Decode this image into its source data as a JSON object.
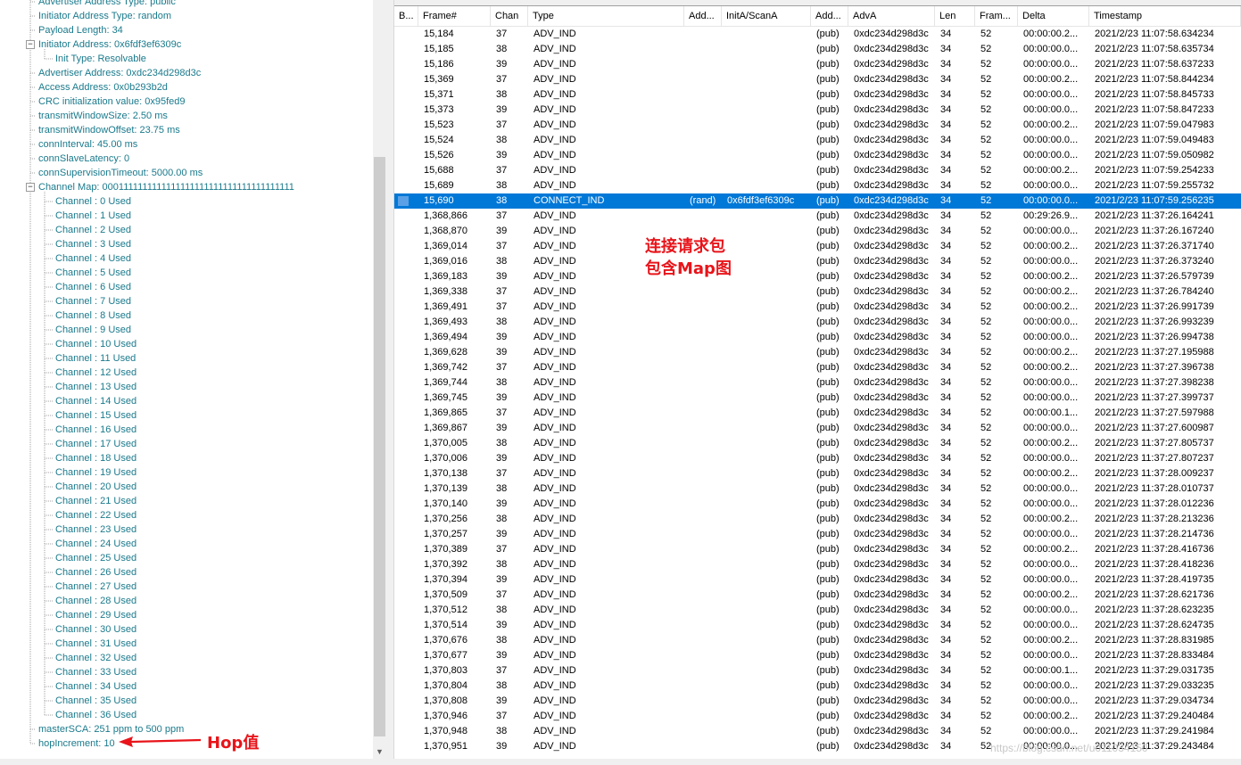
{
  "tree": {
    "nodes": [
      {
        "text": "Advertiser Address Type: public",
        "indent": 1,
        "toggle": ""
      },
      {
        "text": "Initiator Address Type: random",
        "indent": 1,
        "toggle": ""
      },
      {
        "text": "Payload Length: 34",
        "indent": 1,
        "toggle": ""
      },
      {
        "text": "Initiator Address: 0x6fdf3ef6309c",
        "indent": 1,
        "toggle": "−"
      },
      {
        "text": "Init Type: Resolvable",
        "indent": 2,
        "toggle": ""
      },
      {
        "text": "Advertiser Address: 0xdc234d298d3c",
        "indent": 1,
        "toggle": ""
      },
      {
        "text": "Access Address: 0x0b293b2d",
        "indent": 1,
        "toggle": ""
      },
      {
        "text": "CRC initialization value: 0x95fed9",
        "indent": 1,
        "toggle": ""
      },
      {
        "text": "transmitWindowSize: 2.50  ms",
        "indent": 1,
        "toggle": ""
      },
      {
        "text": "transmitWindowOffset: 23.75  ms",
        "indent": 1,
        "toggle": ""
      },
      {
        "text": "connInterval: 45.00  ms",
        "indent": 1,
        "toggle": ""
      },
      {
        "text": "connSlaveLatency: 0",
        "indent": 1,
        "toggle": ""
      },
      {
        "text": "connSupervisionTimeout: 5000.00  ms",
        "indent": 1,
        "toggle": ""
      },
      {
        "text": "Channel Map: 0001111111111111111111111111111111111111",
        "indent": 1,
        "toggle": "−"
      },
      {
        "text": "Channel : 0 Used",
        "indent": 2,
        "toggle": ""
      },
      {
        "text": "Channel : 1 Used",
        "indent": 2,
        "toggle": ""
      },
      {
        "text": "Channel : 2 Used",
        "indent": 2,
        "toggle": ""
      },
      {
        "text": "Channel : 3 Used",
        "indent": 2,
        "toggle": ""
      },
      {
        "text": "Channel : 4 Used",
        "indent": 2,
        "toggle": ""
      },
      {
        "text": "Channel : 5 Used",
        "indent": 2,
        "toggle": ""
      },
      {
        "text": "Channel : 6 Used",
        "indent": 2,
        "toggle": ""
      },
      {
        "text": "Channel : 7 Used",
        "indent": 2,
        "toggle": ""
      },
      {
        "text": "Channel : 8 Used",
        "indent": 2,
        "toggle": ""
      },
      {
        "text": "Channel : 9 Used",
        "indent": 2,
        "toggle": ""
      },
      {
        "text": "Channel : 10 Used",
        "indent": 2,
        "toggle": ""
      },
      {
        "text": "Channel : 11 Used",
        "indent": 2,
        "toggle": ""
      },
      {
        "text": "Channel : 12 Used",
        "indent": 2,
        "toggle": ""
      },
      {
        "text": "Channel : 13 Used",
        "indent": 2,
        "toggle": ""
      },
      {
        "text": "Channel : 14 Used",
        "indent": 2,
        "toggle": ""
      },
      {
        "text": "Channel : 15 Used",
        "indent": 2,
        "toggle": ""
      },
      {
        "text": "Channel : 16 Used",
        "indent": 2,
        "toggle": ""
      },
      {
        "text": "Channel : 17 Used",
        "indent": 2,
        "toggle": ""
      },
      {
        "text": "Channel : 18 Used",
        "indent": 2,
        "toggle": ""
      },
      {
        "text": "Channel : 19 Used",
        "indent": 2,
        "toggle": ""
      },
      {
        "text": "Channel : 20 Used",
        "indent": 2,
        "toggle": ""
      },
      {
        "text": "Channel : 21 Used",
        "indent": 2,
        "toggle": ""
      },
      {
        "text": "Channel : 22 Used",
        "indent": 2,
        "toggle": ""
      },
      {
        "text": "Channel : 23 Used",
        "indent": 2,
        "toggle": ""
      },
      {
        "text": "Channel : 24 Used",
        "indent": 2,
        "toggle": ""
      },
      {
        "text": "Channel : 25 Used",
        "indent": 2,
        "toggle": ""
      },
      {
        "text": "Channel : 26 Used",
        "indent": 2,
        "toggle": ""
      },
      {
        "text": "Channel : 27 Used",
        "indent": 2,
        "toggle": ""
      },
      {
        "text": "Channel : 28 Used",
        "indent": 2,
        "toggle": ""
      },
      {
        "text": "Channel : 29 Used",
        "indent": 2,
        "toggle": ""
      },
      {
        "text": "Channel : 30 Used",
        "indent": 2,
        "toggle": ""
      },
      {
        "text": "Channel : 31 Used",
        "indent": 2,
        "toggle": ""
      },
      {
        "text": "Channel : 32 Used",
        "indent": 2,
        "toggle": ""
      },
      {
        "text": "Channel : 33 Used",
        "indent": 2,
        "toggle": ""
      },
      {
        "text": "Channel : 34 Used",
        "indent": 2,
        "toggle": ""
      },
      {
        "text": "Channel : 35 Used",
        "indent": 2,
        "toggle": ""
      },
      {
        "text": "Channel : 36 Used",
        "indent": 2,
        "toggle": ""
      },
      {
        "text": "masterSCA: 251 ppm to 500 ppm",
        "indent": 1,
        "toggle": ""
      },
      {
        "text": "hopIncrement: 10",
        "indent": 1,
        "toggle": ""
      }
    ]
  },
  "grid": {
    "columns": [
      "B...",
      "Frame#",
      "Chan",
      "Type",
      "Add...",
      "InitA/ScanA",
      "Add...",
      "AdvA",
      "Len",
      "Fram...",
      "Delta",
      "Timestamp"
    ],
    "rows": [
      [
        "",
        "15,184",
        "37",
        "ADV_IND",
        "",
        "",
        "(pub)",
        "0xdc234d298d3c",
        "34",
        "52",
        "00:00:00.2...",
        "2021/2/23 11:07:58.634234"
      ],
      [
        "",
        "15,185",
        "38",
        "ADV_IND",
        "",
        "",
        "(pub)",
        "0xdc234d298d3c",
        "34",
        "52",
        "00:00:00.0...",
        "2021/2/23 11:07:58.635734"
      ],
      [
        "",
        "15,186",
        "39",
        "ADV_IND",
        "",
        "",
        "(pub)",
        "0xdc234d298d3c",
        "34",
        "52",
        "00:00:00.0...",
        "2021/2/23 11:07:58.637233"
      ],
      [
        "",
        "15,369",
        "37",
        "ADV_IND",
        "",
        "",
        "(pub)",
        "0xdc234d298d3c",
        "34",
        "52",
        "00:00:00.2...",
        "2021/2/23 11:07:58.844234"
      ],
      [
        "",
        "15,371",
        "38",
        "ADV_IND",
        "",
        "",
        "(pub)",
        "0xdc234d298d3c",
        "34",
        "52",
        "00:00:00.0...",
        "2021/2/23 11:07:58.845733"
      ],
      [
        "",
        "15,373",
        "39",
        "ADV_IND",
        "",
        "",
        "(pub)",
        "0xdc234d298d3c",
        "34",
        "52",
        "00:00:00.0...",
        "2021/2/23 11:07:58.847233"
      ],
      [
        "",
        "15,523",
        "37",
        "ADV_IND",
        "",
        "",
        "(pub)",
        "0xdc234d298d3c",
        "34",
        "52",
        "00:00:00.2...",
        "2021/2/23 11:07:59.047983"
      ],
      [
        "",
        "15,524",
        "38",
        "ADV_IND",
        "",
        "",
        "(pub)",
        "0xdc234d298d3c",
        "34",
        "52",
        "00:00:00.0...",
        "2021/2/23 11:07:59.049483"
      ],
      [
        "",
        "15,526",
        "39",
        "ADV_IND",
        "",
        "",
        "(pub)",
        "0xdc234d298d3c",
        "34",
        "52",
        "00:00:00.0...",
        "2021/2/23 11:07:59.050982"
      ],
      [
        "",
        "15,688",
        "37",
        "ADV_IND",
        "",
        "",
        "(pub)",
        "0xdc234d298d3c",
        "34",
        "52",
        "00:00:00.2...",
        "2021/2/23 11:07:59.254233"
      ],
      [
        "",
        "15,689",
        "38",
        "ADV_IND",
        "",
        "",
        "(pub)",
        "0xdc234d298d3c",
        "34",
        "52",
        "00:00:00.0...",
        "2021/2/23 11:07:59.255732"
      ],
      [
        "",
        "15,690",
        "38",
        "CONNECT_IND",
        "(rand)",
        "0x6fdf3ef6309c",
        "(pub)",
        "0xdc234d298d3c",
        "34",
        "52",
        "00:00:00.0...",
        "2021/2/23 11:07:59.256235"
      ],
      [
        "",
        "1,368,866",
        "37",
        "ADV_IND",
        "",
        "",
        "(pub)",
        "0xdc234d298d3c",
        "34",
        "52",
        "00:29:26.9...",
        "2021/2/23 11:37:26.164241"
      ],
      [
        "",
        "1,368,870",
        "39",
        "ADV_IND",
        "",
        "",
        "(pub)",
        "0xdc234d298d3c",
        "34",
        "52",
        "00:00:00.0...",
        "2021/2/23 11:37:26.167240"
      ],
      [
        "",
        "1,369,014",
        "37",
        "ADV_IND",
        "",
        "",
        "(pub)",
        "0xdc234d298d3c",
        "34",
        "52",
        "00:00:00.2...",
        "2021/2/23 11:37:26.371740"
      ],
      [
        "",
        "1,369,016",
        "38",
        "ADV_IND",
        "",
        "",
        "(pub)",
        "0xdc234d298d3c",
        "34",
        "52",
        "00:00:00.0...",
        "2021/2/23 11:37:26.373240"
      ],
      [
        "",
        "1,369,183",
        "39",
        "ADV_IND",
        "",
        "",
        "(pub)",
        "0xdc234d298d3c",
        "34",
        "52",
        "00:00:00.2...",
        "2021/2/23 11:37:26.579739"
      ],
      [
        "",
        "1,369,338",
        "37",
        "ADV_IND",
        "",
        "",
        "(pub)",
        "0xdc234d298d3c",
        "34",
        "52",
        "00:00:00.2...",
        "2021/2/23 11:37:26.784240"
      ],
      [
        "",
        "1,369,491",
        "37",
        "ADV_IND",
        "",
        "",
        "(pub)",
        "0xdc234d298d3c",
        "34",
        "52",
        "00:00:00.2...",
        "2021/2/23 11:37:26.991739"
      ],
      [
        "",
        "1,369,493",
        "38",
        "ADV_IND",
        "",
        "",
        "(pub)",
        "0xdc234d298d3c",
        "34",
        "52",
        "00:00:00.0...",
        "2021/2/23 11:37:26.993239"
      ],
      [
        "",
        "1,369,494",
        "39",
        "ADV_IND",
        "",
        "",
        "(pub)",
        "0xdc234d298d3c",
        "34",
        "52",
        "00:00:00.0...",
        "2021/2/23 11:37:26.994738"
      ],
      [
        "",
        "1,369,628",
        "39",
        "ADV_IND",
        "",
        "",
        "(pub)",
        "0xdc234d298d3c",
        "34",
        "52",
        "00:00:00.2...",
        "2021/2/23 11:37:27.195988"
      ],
      [
        "",
        "1,369,742",
        "37",
        "ADV_IND",
        "",
        "",
        "(pub)",
        "0xdc234d298d3c",
        "34",
        "52",
        "00:00:00.2...",
        "2021/2/23 11:37:27.396738"
      ],
      [
        "",
        "1,369,744",
        "38",
        "ADV_IND",
        "",
        "",
        "(pub)",
        "0xdc234d298d3c",
        "34",
        "52",
        "00:00:00.0...",
        "2021/2/23 11:37:27.398238"
      ],
      [
        "",
        "1,369,745",
        "39",
        "ADV_IND",
        "",
        "",
        "(pub)",
        "0xdc234d298d3c",
        "34",
        "52",
        "00:00:00.0...",
        "2021/2/23 11:37:27.399737"
      ],
      [
        "",
        "1,369,865",
        "37",
        "ADV_IND",
        "",
        "",
        "(pub)",
        "0xdc234d298d3c",
        "34",
        "52",
        "00:00:00.1...",
        "2021/2/23 11:37:27.597988"
      ],
      [
        "",
        "1,369,867",
        "39",
        "ADV_IND",
        "",
        "",
        "(pub)",
        "0xdc234d298d3c",
        "34",
        "52",
        "00:00:00.0...",
        "2021/2/23 11:37:27.600987"
      ],
      [
        "",
        "1,370,005",
        "38",
        "ADV_IND",
        "",
        "",
        "(pub)",
        "0xdc234d298d3c",
        "34",
        "52",
        "00:00:00.2...",
        "2021/2/23 11:37:27.805737"
      ],
      [
        "",
        "1,370,006",
        "39",
        "ADV_IND",
        "",
        "",
        "(pub)",
        "0xdc234d298d3c",
        "34",
        "52",
        "00:00:00.0...",
        "2021/2/23 11:37:27.807237"
      ],
      [
        "",
        "1,370,138",
        "37",
        "ADV_IND",
        "",
        "",
        "(pub)",
        "0xdc234d298d3c",
        "34",
        "52",
        "00:00:00.2...",
        "2021/2/23 11:37:28.009237"
      ],
      [
        "",
        "1,370,139",
        "38",
        "ADV_IND",
        "",
        "",
        "(pub)",
        "0xdc234d298d3c",
        "34",
        "52",
        "00:00:00.0...",
        "2021/2/23 11:37:28.010737"
      ],
      [
        "",
        "1,370,140",
        "39",
        "ADV_IND",
        "",
        "",
        "(pub)",
        "0xdc234d298d3c",
        "34",
        "52",
        "00:00:00.0...",
        "2021/2/23 11:37:28.012236"
      ],
      [
        "",
        "1,370,256",
        "38",
        "ADV_IND",
        "",
        "",
        "(pub)",
        "0xdc234d298d3c",
        "34",
        "52",
        "00:00:00.2...",
        "2021/2/23 11:37:28.213236"
      ],
      [
        "",
        "1,370,257",
        "39",
        "ADV_IND",
        "",
        "",
        "(pub)",
        "0xdc234d298d3c",
        "34",
        "52",
        "00:00:00.0...",
        "2021/2/23 11:37:28.214736"
      ],
      [
        "",
        "1,370,389",
        "37",
        "ADV_IND",
        "",
        "",
        "(pub)",
        "0xdc234d298d3c",
        "34",
        "52",
        "00:00:00.2...",
        "2021/2/23 11:37:28.416736"
      ],
      [
        "",
        "1,370,392",
        "38",
        "ADV_IND",
        "",
        "",
        "(pub)",
        "0xdc234d298d3c",
        "34",
        "52",
        "00:00:00.0...",
        "2021/2/23 11:37:28.418236"
      ],
      [
        "",
        "1,370,394",
        "39",
        "ADV_IND",
        "",
        "",
        "(pub)",
        "0xdc234d298d3c",
        "34",
        "52",
        "00:00:00.0...",
        "2021/2/23 11:37:28.419735"
      ],
      [
        "",
        "1,370,509",
        "37",
        "ADV_IND",
        "",
        "",
        "(pub)",
        "0xdc234d298d3c",
        "34",
        "52",
        "00:00:00.2...",
        "2021/2/23 11:37:28.621736"
      ],
      [
        "",
        "1,370,512",
        "38",
        "ADV_IND",
        "",
        "",
        "(pub)",
        "0xdc234d298d3c",
        "34",
        "52",
        "00:00:00.0...",
        "2021/2/23 11:37:28.623235"
      ],
      [
        "",
        "1,370,514",
        "39",
        "ADV_IND",
        "",
        "",
        "(pub)",
        "0xdc234d298d3c",
        "34",
        "52",
        "00:00:00.0...",
        "2021/2/23 11:37:28.624735"
      ],
      [
        "",
        "1,370,676",
        "38",
        "ADV_IND",
        "",
        "",
        "(pub)",
        "0xdc234d298d3c",
        "34",
        "52",
        "00:00:00.2...",
        "2021/2/23 11:37:28.831985"
      ],
      [
        "",
        "1,370,677",
        "39",
        "ADV_IND",
        "",
        "",
        "(pub)",
        "0xdc234d298d3c",
        "34",
        "52",
        "00:00:00.0...",
        "2021/2/23 11:37:28.833484"
      ],
      [
        "",
        "1,370,803",
        "37",
        "ADV_IND",
        "",
        "",
        "(pub)",
        "0xdc234d298d3c",
        "34",
        "52",
        "00:00:00.1...",
        "2021/2/23 11:37:29.031735"
      ],
      [
        "",
        "1,370,804",
        "38",
        "ADV_IND",
        "",
        "",
        "(pub)",
        "0xdc234d298d3c",
        "34",
        "52",
        "00:00:00.0...",
        "2021/2/23 11:37:29.033235"
      ],
      [
        "",
        "1,370,808",
        "39",
        "ADV_IND",
        "",
        "",
        "(pub)",
        "0xdc234d298d3c",
        "34",
        "52",
        "00:00:00.0...",
        "2021/2/23 11:37:29.034734"
      ],
      [
        "",
        "1,370,946",
        "37",
        "ADV_IND",
        "",
        "",
        "(pub)",
        "0xdc234d298d3c",
        "34",
        "52",
        "00:00:00.2...",
        "2021/2/23 11:37:29.240484"
      ],
      [
        "",
        "1,370,948",
        "38",
        "ADV_IND",
        "",
        "",
        "(pub)",
        "0xdc234d298d3c",
        "34",
        "52",
        "00:00:00.0...",
        "2021/2/23 11:37:29.241984"
      ],
      [
        "",
        "1,370,951",
        "39",
        "ADV_IND",
        "",
        "",
        "(pub)",
        "0xdc234d298d3c",
        "34",
        "52",
        "00:00:00.0...",
        "2021/2/23 11:37:29.243484"
      ]
    ],
    "selected_frame": "15,690"
  },
  "annotations": {
    "connect_note_line1": "连接请求包",
    "connect_note_line2": "包含Map图",
    "hop_note": "Hop值",
    "color": "#e8141a"
  },
  "watermark": "https://blog.csdn.net/u011034150",
  "colors": {
    "tree_text": "#1a7a8c",
    "selection": "#0078d7"
  }
}
